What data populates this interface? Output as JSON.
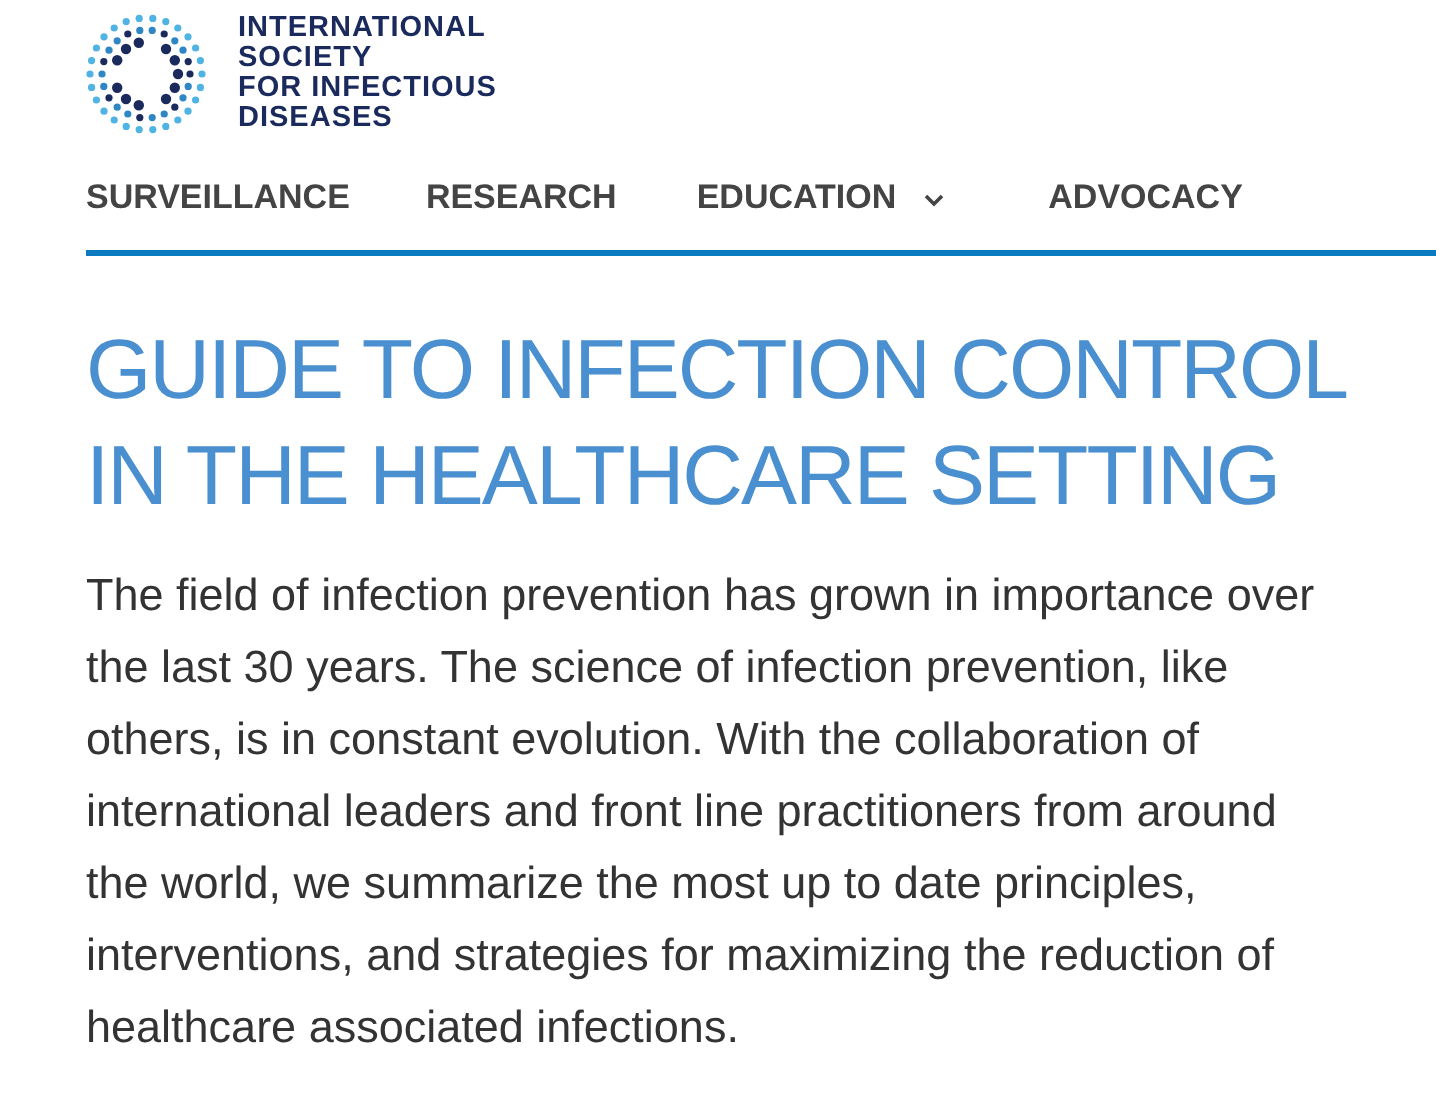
{
  "logo": {
    "lines": [
      "INTERNATIONAL",
      "SOCIETY",
      "FOR INFECTIOUS",
      "DISEASES"
    ]
  },
  "nav": [
    {
      "label": "SURVEILLANCE",
      "has_dropdown": false
    },
    {
      "label": "RESEARCH",
      "has_dropdown": false
    },
    {
      "label": "EDUCATION",
      "has_dropdown": true
    },
    {
      "label": "ADVOCACY",
      "has_dropdown": false
    }
  ],
  "title_lines": [
    "GUIDE TO INFECTION CONTROL",
    "IN THE HEALTHCARE SETTING"
  ],
  "intro": "The field of infection prevention has grown in importance over the last 30 years. The science of infection prevention, like others, is in constant evolution. With the collaboration of international leaders and front line practitioners from around the world, we summarize the most up to date principles, interventions, and strategies for maximizing the reduction of healthcare associated infections."
}
